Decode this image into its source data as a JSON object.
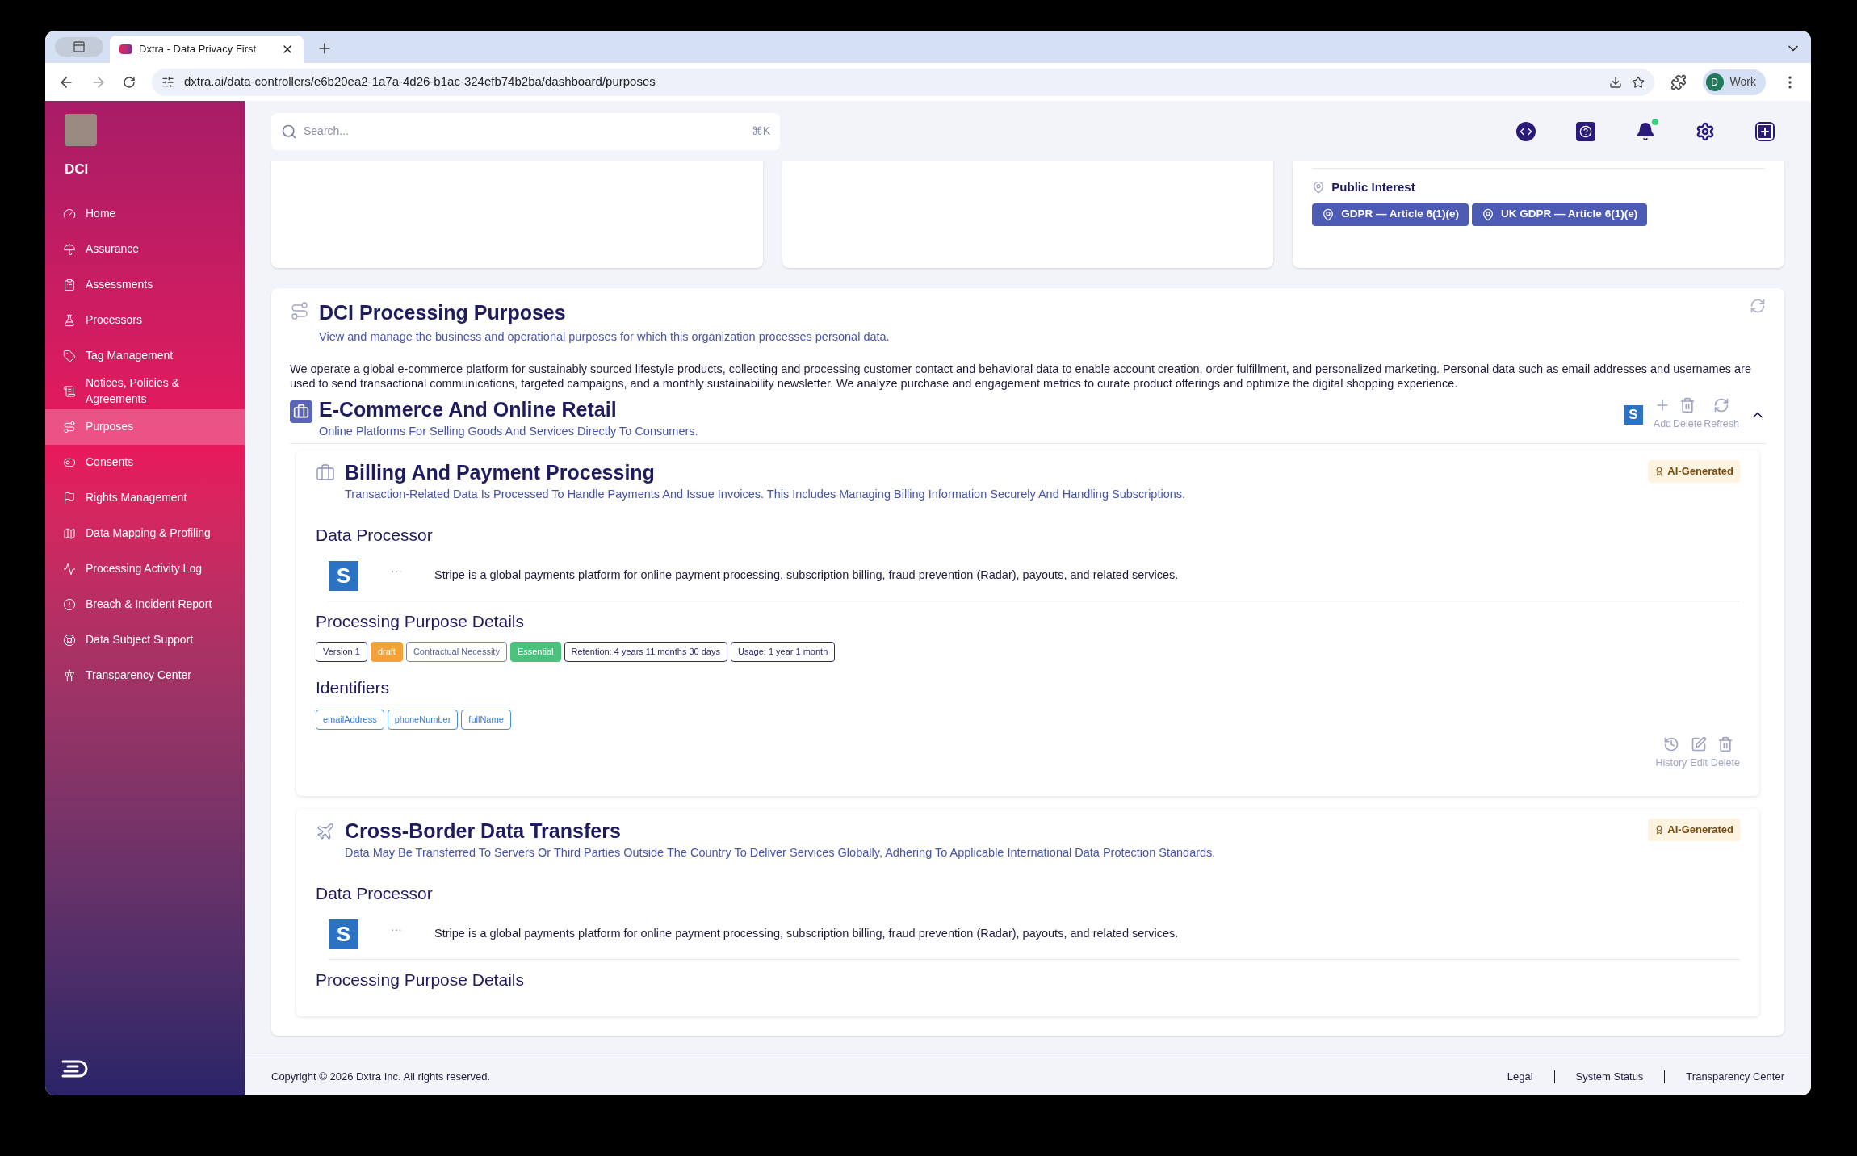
{
  "browser": {
    "tabs": [
      {
        "title": "Dxtra - Data Privacy First",
        "selected": true
      }
    ],
    "url": "dxtra.ai/data-controllers/e6b20ea2-1a7a-4d26-b1ac-324efb74b2ba/dashboard/purposes",
    "profile_initial": "D",
    "profile_name": "Work"
  },
  "sidebar": {
    "org": "DCI",
    "items": [
      {
        "label": "Home",
        "selected": false
      },
      {
        "label": "Assurance",
        "selected": false
      },
      {
        "label": "Assessments",
        "selected": false
      },
      {
        "label": "Processors",
        "selected": false
      },
      {
        "label": "Tag Management",
        "selected": false
      },
      {
        "label": "Notices, Policies & Agreements",
        "selected": false
      },
      {
        "label": "Purposes",
        "selected": true
      },
      {
        "label": "Consents",
        "selected": false
      },
      {
        "label": "Rights Management",
        "selected": false
      },
      {
        "label": "Data Mapping & Profiling",
        "selected": false
      },
      {
        "label": "Processing Activity Log",
        "selected": false
      },
      {
        "label": "Breach & Incident Report",
        "selected": false
      },
      {
        "label": "Data Subject Support",
        "selected": false
      },
      {
        "label": "Transparency Center",
        "selected": false
      }
    ]
  },
  "search": {
    "placeholder": "Search...",
    "shortcut": "⌘K"
  },
  "notifications": {
    "unread": true
  },
  "legal_basis_card": {
    "basis": "Public Interest",
    "chips": [
      "GDPR — Article 6(1)(e)",
      "UK GDPR — Article 6(1)(e)"
    ]
  },
  "section": {
    "title": "DCI Processing Purposes",
    "subtitle": "View and manage the business and operational purposes for which this organization processes personal data.",
    "description": "We operate a global e-commerce platform for sustainably sourced lifestyle products, collecting and processing customer contact and behavioral data to enable account creation, order fulfillment, and personalized marketing. Personal data such as email addresses and usernames are used to send transactional communications, targeted campaigns, and a monthly sustainability newsletter. We analyze purchase and engagement metrics to curate product offerings and optimize the digital shopping experience.",
    "category": {
      "title": "E-Commerce And Online Retail",
      "subtitle": "Online Platforms For Selling Goods And Services Directly To Consumers.",
      "processor_logo": "S",
      "actions": [
        "Add",
        "Delete",
        "Refresh"
      ],
      "expanded": true
    }
  },
  "purposes": [
    {
      "title": "Billing And Payment Processing",
      "description": "Transaction-Related Data Is Processed To Handle Payments And Issue Invoices. This Includes Managing Billing Information Securely And Handling Subscriptions.",
      "badge": "AI-Generated",
      "processor_heading": "Data Processor",
      "processor": {
        "logo": "S",
        "more": "···",
        "description": "Stripe is a global payments platform for online payment processing, subscription billing, fraud prevention (Radar), payouts, and related services."
      },
      "details_heading": "Processing Purpose Details",
      "tags": [
        {
          "label": "Version 1",
          "kind": "outline"
        },
        {
          "label": "draft",
          "kind": "draft"
        },
        {
          "label": "Contractual Necessity",
          "kind": "muted"
        },
        {
          "label": "Essential",
          "kind": "success"
        },
        {
          "label": "Retention: 4 years 11 months 30 days",
          "kind": "outline"
        },
        {
          "label": "Usage: 1 year 1 month",
          "kind": "outline"
        }
      ],
      "identifiers_heading": "Identifiers",
      "identifiers": [
        "emailAddress",
        "phoneNumber",
        "fullName"
      ],
      "actions": [
        "History",
        "Edit",
        "Delete"
      ]
    },
    {
      "title": "Cross-Border Data Transfers",
      "description": "Data May Be Transferred To Servers Or Third Parties Outside The Country To Deliver Services Globally, Adhering To Applicable International Data Protection Standards.",
      "badge": "AI-Generated",
      "processor_heading": "Data Processor",
      "processor": {
        "logo": "S",
        "more": "···",
        "description": "Stripe is a global payments platform for online payment processing, subscription billing, fraud prevention (Radar), payouts, and related services."
      },
      "details_heading": "Processing Purpose Details"
    }
  ],
  "footer": {
    "copyright": "Copyright © 2026 Dxtra Inc. All rights reserved.",
    "links": [
      "Legal",
      "System Status",
      "Transparency Center"
    ]
  }
}
